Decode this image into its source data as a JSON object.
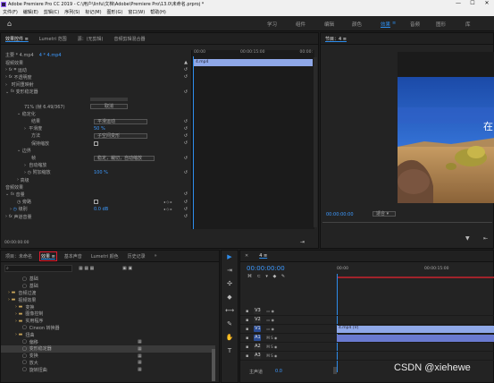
{
  "titlebar": {
    "title": "Adobe Premiere Pro CC 2019 - C:\\用户\\linfu\\文档\\Adobe\\Premiere Pro\\13.0\\未命名.prproj *",
    "min": "—",
    "max": "☐",
    "close": "✕"
  },
  "menu": [
    "文件(F)",
    "编辑(E)",
    "剪辑(C)",
    "序列(S)",
    "标记(M)",
    "图形(G)",
    "窗口(W)",
    "帮助(H)"
  ],
  "workspaces": [
    "学习",
    "组件",
    "编辑",
    "颜色",
    "效果",
    "音频",
    "图形",
    "库"
  ],
  "active_workspace": "效果",
  "effect_controls": {
    "tabs": [
      "效果控件 ≡",
      "Lumetri 范围",
      "源：(无剪辑)",
      "音频剪辑混合器"
    ],
    "source": "主要 * 4.mp4",
    "clip": "4 * 4.mp4",
    "timecodes": [
      "00:00",
      "00:00:15:00",
      "00:00:"
    ],
    "clip_block": "4.mp4",
    "sections": {
      "video": "视频效果",
      "motion": "运动",
      "opacity": "不透明度",
      "time_remap": "时间重映射",
      "warp": "变形稳定器",
      "status": "71% (帧 6.49/367)",
      "cancel": "取消",
      "stabilize": "稳定化",
      "result_label": "结果",
      "result_value": "平滑运动",
      "smooth_label": "平滑度",
      "smooth_value": "50 %",
      "method_label": "方法",
      "method_value": "子空间变形",
      "keep_scale": "保持缩放",
      "borders": "边界",
      "frame_label": "帧",
      "frame_value": "稳定，裁切，自动缩放",
      "auto_scale": "自动缩放",
      "crop_label": "附加缩放",
      "crop_value": "100 %",
      "advanced": "高级",
      "audio": "音频效果",
      "volume": "音量",
      "bypass": "旁路",
      "level_label": "级别",
      "level_value": "0.0 dB",
      "channel_volume": "声道音量"
    },
    "time": "00:00:00:00"
  },
  "program": {
    "tab": "节目：4 ≡",
    "overlay_text": "在",
    "timecode": "00:00:00:00",
    "fit": "适合",
    "full": "完整",
    "end_time": "00:00:"
  },
  "project": {
    "tabs": [
      "项目：未命名",
      "效果 ≡",
      "基本声音",
      "Lumetri 颜色",
      "历史记录"
    ],
    "search_placeholder": "",
    "tree": [
      {
        "indent": 2,
        "type": "file",
        "label": "基础"
      },
      {
        "indent": 2,
        "type": "file",
        "label": "基础"
      },
      {
        "indent": 0,
        "type": "folder",
        "label": "音频过渡"
      },
      {
        "indent": 0,
        "type": "folder",
        "label": "视频效果"
      },
      {
        "indent": 1,
        "type": "folder",
        "label": "变换"
      },
      {
        "indent": 1,
        "type": "folder",
        "label": "图像控制"
      },
      {
        "indent": 1,
        "type": "folder",
        "label": "实用程序"
      },
      {
        "indent": 2,
        "type": "file",
        "label": "Cineon 转换器"
      },
      {
        "indent": 1,
        "type": "folder",
        "label": "扭曲"
      },
      {
        "indent": 2,
        "type": "file",
        "label": "偏移"
      },
      {
        "indent": 2,
        "type": "file",
        "label": "变形稳定器",
        "selected": true
      },
      {
        "indent": 2,
        "type": "file",
        "label": "变换"
      },
      {
        "indent": 2,
        "type": "file",
        "label": "放大"
      },
      {
        "indent": 2,
        "type": "file",
        "label": "旋转扭曲"
      }
    ]
  },
  "timeline": {
    "tab": "4 ≡",
    "timecode": "00:00:00:00",
    "ruler": [
      "00:00",
      "00:00:15:00"
    ],
    "tracks": [
      {
        "name": "V3",
        "kind": "video"
      },
      {
        "name": "V2",
        "kind": "video"
      },
      {
        "name": "V1",
        "kind": "video",
        "clip": "4.mp4 [V]"
      },
      {
        "name": "A1",
        "kind": "audio"
      },
      {
        "name": "A2",
        "kind": "audio"
      },
      {
        "name": "A3",
        "kind": "audio"
      }
    ],
    "master_label": "主声道",
    "master_value": "0.0"
  },
  "watermark": "CSDN @xiehewe",
  "colors": {
    "accent": "#2d8ceb",
    "clip_video": "#8fa8e8",
    "clip_audio": "#6a7ad0",
    "track_active": "#2b4d96",
    "red_box": "#e0192d"
  }
}
